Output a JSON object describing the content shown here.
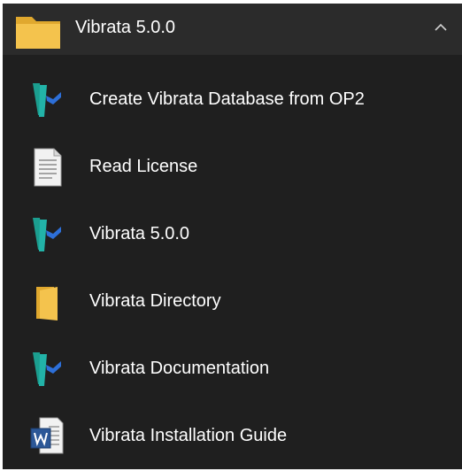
{
  "group": {
    "title": "Vibrata 5.0.0",
    "icon": "folder-icon",
    "expand_icon": "chevron-up-icon"
  },
  "items": [
    {
      "label": "Create Vibrata Database from OP2",
      "icon": "vibrata-app-icon"
    },
    {
      "label": "Read License",
      "icon": "text-document-icon"
    },
    {
      "label": "Vibrata 5.0.0",
      "icon": "vibrata-app-icon"
    },
    {
      "label": "Vibrata Directory",
      "icon": "folder-icon"
    },
    {
      "label": "Vibrata Documentation",
      "icon": "vibrata-app-icon"
    },
    {
      "label": "Vibrata Installation Guide",
      "icon": "word-document-icon"
    }
  ],
  "colors": {
    "background": "#1f1f1f",
    "header_background": "#2b2b2b",
    "text": "#ffffff",
    "folder_yellow": "#f4c34d",
    "vibrata_teal": "#22b3a8",
    "vibrata_blue": "#2d6fd8",
    "word_blue": "#2b5797"
  }
}
